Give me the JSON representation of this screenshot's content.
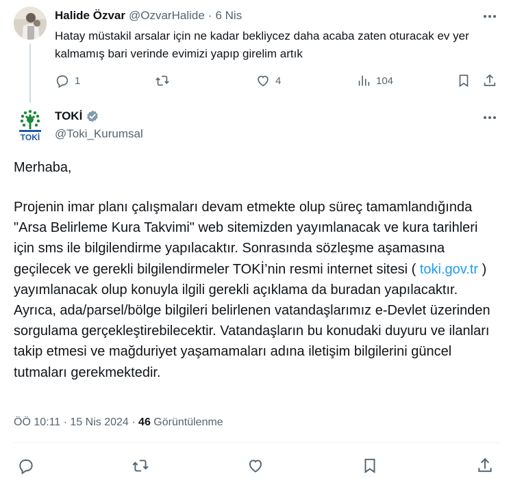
{
  "reply": {
    "author_name": "Halide Özvar",
    "author_handle": "@OzvarHalide",
    "separator": "·",
    "date": "6 Nis",
    "text": "Hatay müstakil arsalar için ne kadar bekliycez daha acaba zaten oturacak ev yer kalmamış bari verinde evimizi yapıp girelim artık",
    "stats": {
      "replies": "1",
      "retweets": "",
      "likes": "4",
      "views": "104"
    }
  },
  "tweet": {
    "author_name": "TOKİ",
    "author_handle": "@Toki_Kurumsal",
    "avatar_label": "TOKİ",
    "greeting": "Merhaba,",
    "body_part1": "Projenin imar planı çalışmaları devam etmekte olup süreç tamamlandığında \"Arsa Belirleme Kura Takvimi\" web sitemizden yayımlanacak ve kura tarihleri için sms ile bilgilendirme yapılacaktır. Sonrasında sözleşme aşamasına geçilecek ve gerekli bilgilendirmeler TOKİ’nin resmi internet sitesi ( ",
    "link_text": "toki.gov.tr",
    "body_part2": " ) yayımlanacak olup konuyla ilgili gerekli açıklama da buradan yapılacaktır. Ayrıca, ada/parsel/bölge bilgileri belirlenen vatandaşlarımız e-Devlet üzerinden sorgulama gerçekleştirebilecektir. Vatandaşların bu konudaki duyuru ve ilanları takip etmesi ve mağduriyet yaşamamaları adına iletişim bilgilerini güncel tutmaları gerekmektedir.",
    "time": "ÖÖ 10:11",
    "meta_separator": "·",
    "date": "15 Nis 2024",
    "views_count": "46",
    "views_label": "Görüntülenme"
  },
  "colors": {
    "text": "#0f1419",
    "secondary": "#536471",
    "link": "#1d9bf0",
    "verified": "#829aab",
    "toki_green": "#1a8a3a",
    "toki_blue": "#1d5aa8"
  },
  "icons": {
    "reply": "reply-icon",
    "retweet": "retweet-icon",
    "like": "heart-icon",
    "views": "views-icon",
    "bookmark": "bookmark-icon",
    "share": "share-icon",
    "more": "more-icon",
    "verified": "verified-badge-icon"
  }
}
